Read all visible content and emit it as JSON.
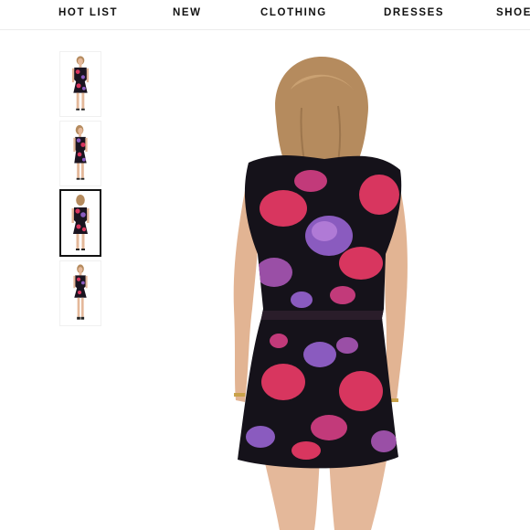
{
  "nav": {
    "items": [
      {
        "label": "HOT LIST"
      },
      {
        "label": "NEW"
      },
      {
        "label": "CLOTHING"
      },
      {
        "label": "DRESSES"
      },
      {
        "label": "SHOES"
      }
    ]
  },
  "gallery": {
    "selected_index": 2,
    "thumbnails": [
      {
        "view": "front"
      },
      {
        "view": "side"
      },
      {
        "view": "back"
      },
      {
        "view": "full-length"
      }
    ]
  },
  "product_image": {
    "view": "back",
    "colors": {
      "dress_base": "#15121a",
      "pink": "#d8365f",
      "purple": "#8a5bbf",
      "skin": "#e4b89a",
      "hair": "#b58b5e"
    }
  }
}
